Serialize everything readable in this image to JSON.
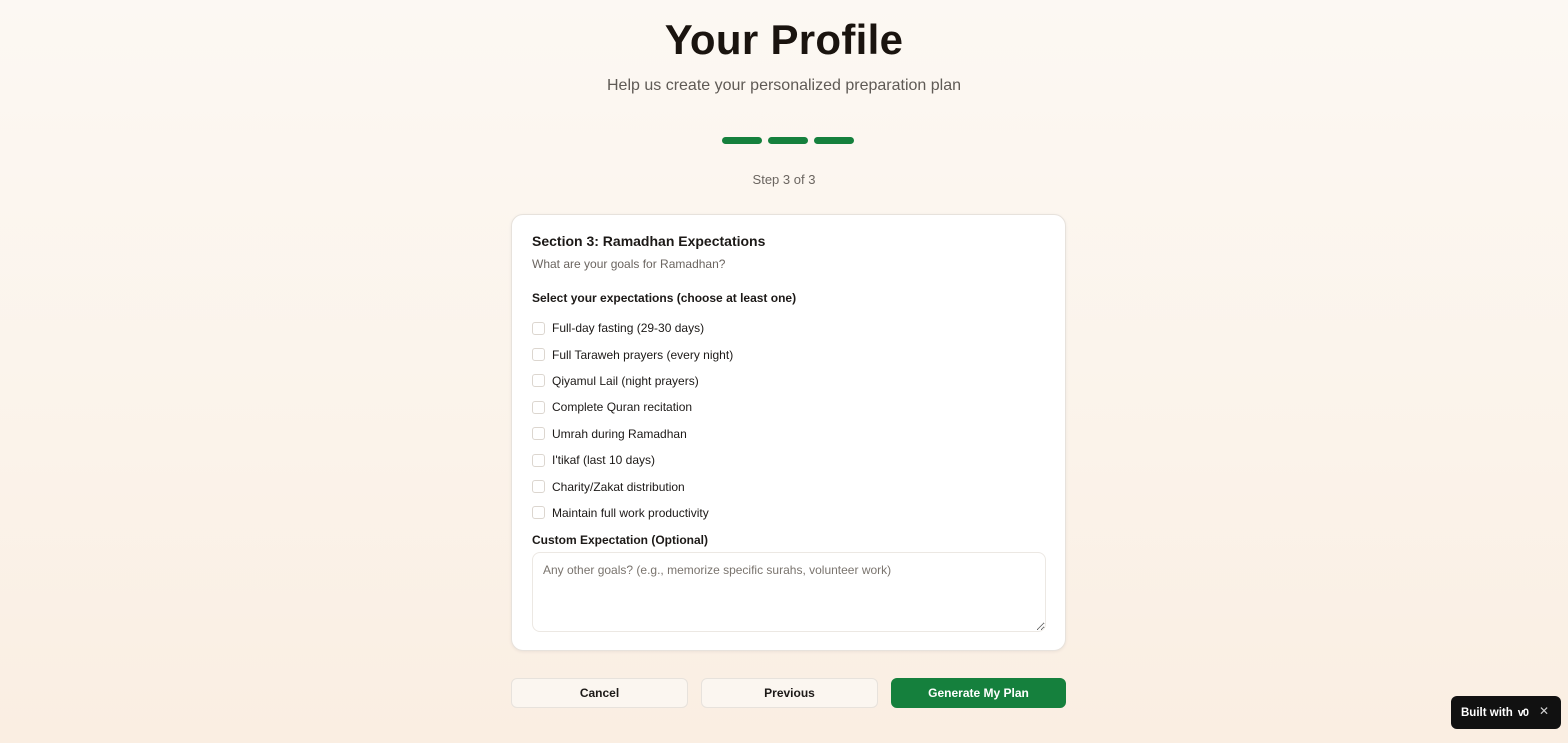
{
  "page": {
    "title": "Your Profile",
    "subtitle": "Help us create your personalized preparation plan"
  },
  "progress": {
    "steps_total": 3,
    "steps_completed": 3,
    "label": "Step 3 of 3",
    "color": "#15803d"
  },
  "section": {
    "title": "Section 3: Ramadhan Expectations",
    "description": "What are your goals for Ramadhan?",
    "select_label": "Select your expectations (choose at least one)",
    "options": [
      {
        "label": "Full-day fasting (29-30 days)",
        "checked": false
      },
      {
        "label": "Full Taraweh prayers (every night)",
        "checked": false
      },
      {
        "label": "Qiyamul Lail (night prayers)",
        "checked": false
      },
      {
        "label": "Complete Quran recitation",
        "checked": false
      },
      {
        "label": "Umrah during Ramadhan",
        "checked": false
      },
      {
        "label": "I'tikaf (last 10 days)",
        "checked": false
      },
      {
        "label": "Charity/Zakat distribution",
        "checked": false
      },
      {
        "label": "Maintain full work productivity",
        "checked": false
      }
    ],
    "custom_label": "Custom Expectation (Optional)",
    "custom_placeholder": "Any other goals? (e.g., memorize specific surahs, volunteer work)",
    "custom_value": ""
  },
  "actions": {
    "cancel_label": "Cancel",
    "previous_label": "Previous",
    "submit_label": "Generate My Plan",
    "submit_color": "#15803d"
  },
  "badge": {
    "text": "Built with",
    "logo": "v0",
    "close_icon": "close-icon"
  }
}
